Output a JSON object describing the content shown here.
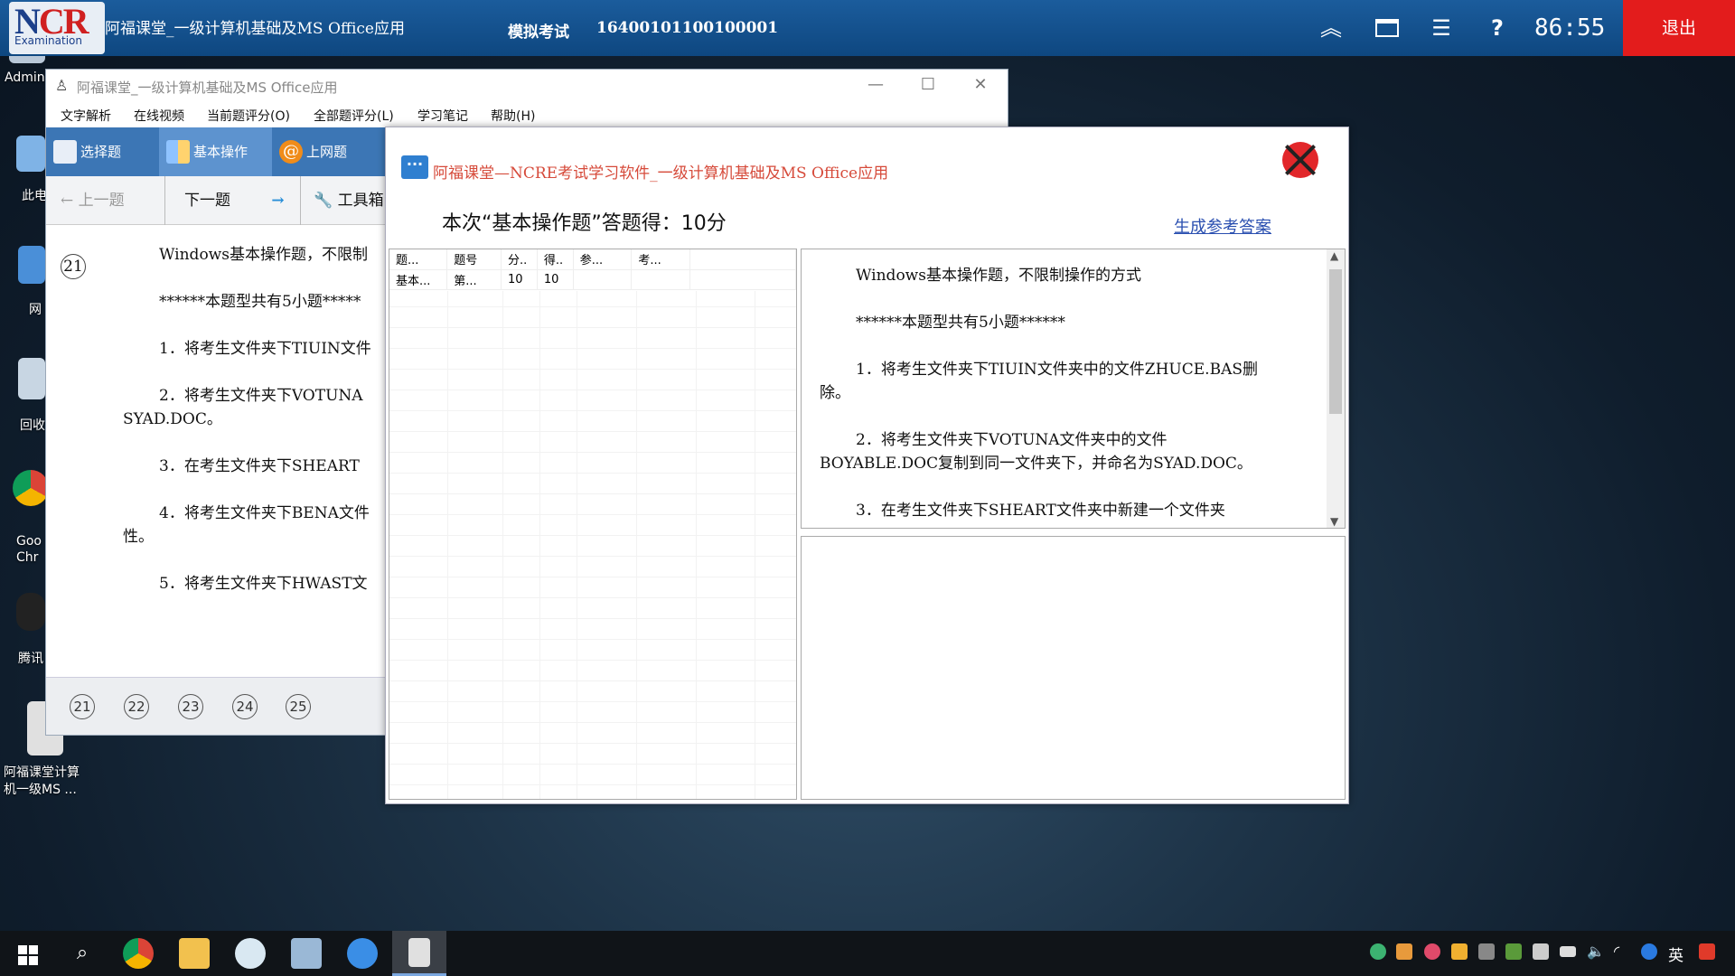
{
  "topbar": {
    "logo_text_n": "N",
    "logo_text_cre": "CR",
    "logo_sub": "Examination",
    "app_title": "阿福课堂_一级计算机基础及MS Office应用",
    "mode": "模拟考试",
    "exam_id": "16400101100100001",
    "timer": "86:55",
    "exit_label": "退出"
  },
  "desktop": {
    "icons": [
      {
        "label": "Admin"
      },
      {
        "label": "此电"
      },
      {
        "label": "网"
      },
      {
        "label": "回收"
      },
      {
        "label": "Goo\nChr"
      },
      {
        "label": "腾讯"
      },
      {
        "label": "阿福课堂计算\n机一级MS ..."
      }
    ]
  },
  "main_window": {
    "title": "阿福课堂_一级计算机基础及MS Office应用",
    "menu": [
      "文字解析",
      "在线视频",
      "当前题评分(O)",
      "全部题评分(L)",
      "学习笔记",
      "帮助(H)"
    ],
    "tabs": [
      "选择题",
      "基本操作",
      "上网题"
    ],
    "nav": {
      "prev": "上一题",
      "next": "下一题",
      "tools": "工具箱"
    },
    "current_qnum": "21",
    "question_lines": [
      "Windows基本操作题，不限制",
      "******本题型共有5小题*****",
      "1．将考生文件夹下TIUIN文件",
      "2．将考生文件夹下VOTUNA",
      "SYAD.DOC。",
      "3．在考生文件夹下SHEART",
      "4．将考生文件夹下BENA文件",
      "性。",
      "5．将考生文件夹下HWAST文"
    ],
    "question_numbers": [
      "21",
      "22",
      "23",
      "24",
      "25"
    ]
  },
  "dialog": {
    "title": "阿福课堂—NCRE考试学习软件_一级计算机基础及MS Office应用",
    "score_text": "本次“基本操作题”答题得：10分",
    "generate_link": "生成参考答案",
    "table": {
      "headers": [
        "题...",
        "题号",
        "分..",
        "得..",
        "参...",
        "考..."
      ],
      "rows": [
        [
          "基本...",
          "第...",
          "10",
          "10",
          "",
          ""
        ]
      ]
    },
    "answer_lines": [
      "Windows基本操作题，不限制操作的方式",
      "******本题型共有5小题******",
      "1．将考生文件夹下TIUIN文件夹中的文件ZHUCE.BAS删",
      "除。",
      "2．将考生文件夹下VOTUNA文件夹中的文件",
      "BOYABLE.DOC复制到同一文件夹下，并命名为SYAD.DOC。",
      "3．在考生文件夹下SHEART文件夹中新建一个文件夹"
    ]
  },
  "taskbar": {
    "ime": "英"
  },
  "colors": {
    "topbar": "#0e4780",
    "exit": "#e31c1c",
    "dialog_title": "#d64a3a",
    "link": "#2a4fb0"
  }
}
